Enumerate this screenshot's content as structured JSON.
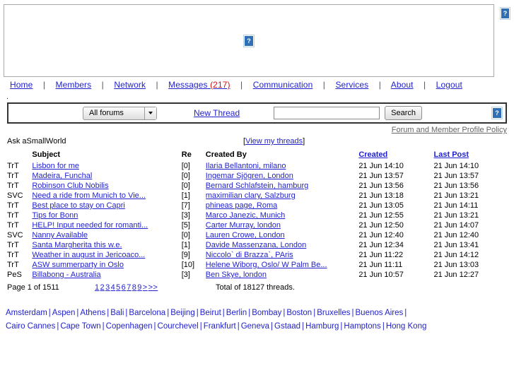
{
  "banner": {
    "center_icon": "broken-image-icon",
    "right_icon": "broken-image-icon"
  },
  "nav": {
    "separator": "|",
    "items": [
      {
        "label": "Home"
      },
      {
        "label": "Members"
      },
      {
        "label": "Network"
      },
      {
        "label": "Messages",
        "count": "(217)"
      },
      {
        "label": "Communication"
      },
      {
        "label": "Services"
      },
      {
        "label": "About"
      },
      {
        "label": "Logout"
      }
    ]
  },
  "stray_text": ".",
  "toolbar": {
    "forum_selected": "All forums",
    "forum_options": [
      "All forums"
    ],
    "new_thread_label": "New Thread",
    "search_value": "",
    "search_placeholder": "",
    "search_button_label": "Search",
    "help_icon": "broken-image-icon"
  },
  "policy": {
    "link_label": "Forum and Member Profile Policy"
  },
  "forum": {
    "name": "Ask aSmallWorld",
    "view_my_threads_open": "[",
    "view_my_threads": "View my threads",
    "view_my_threads_close": "]"
  },
  "table": {
    "headers": {
      "type": "",
      "subject": "Subject",
      "re": "Re",
      "created_by": "Created By",
      "created": "Created",
      "last_post": "Last Post"
    },
    "rows": [
      {
        "type": "TrT",
        "subject": "Lisbon for me",
        "re": "[0]",
        "created_by": "Ilaria Bellantoni, milano",
        "created": "21 Jun 14:10",
        "last_post": "21 Jun 14:10"
      },
      {
        "type": "TrT",
        "subject": "Madeira, Funchal",
        "re": "[0]",
        "created_by": "Ingemar Sjögren, London",
        "created": "21 Jun 13:57",
        "last_post": "21 Jun 13:57"
      },
      {
        "type": "TrT",
        "subject": "Robinson Club Nobilis",
        "re": "[0]",
        "created_by": "Bernard Schlafstein, hamburg",
        "created": "21 Jun 13:56",
        "last_post": "21 Jun 13:56"
      },
      {
        "type": "SVC",
        "subject": "Need a ride from Munich to Vie...",
        "re": "[1]",
        "created_by": "maximilian clary, Salzburg",
        "created": "21 Jun 13:18",
        "last_post": "21 Jun 13:21"
      },
      {
        "type": "TrT",
        "subject": "Best place to stay on Capri",
        "re": "[7]",
        "created_by": "phineas page, Roma",
        "created": "21 Jun 13:05",
        "last_post": "21 Jun 14:11"
      },
      {
        "type": "TrT",
        "subject": "Tips for Bonn",
        "re": "[3]",
        "created_by": "Marco Janezic, Munich",
        "created": "21 Jun 12:55",
        "last_post": "21 Jun 13:21"
      },
      {
        "type": "TrT",
        "subject": "HELP! Input needed for romanti...",
        "re": "[5]",
        "created_by": "Carter Murray, london",
        "created": "21 Jun 12:50",
        "last_post": "21 Jun 14:07"
      },
      {
        "type": "SVC",
        "subject": "Nanny Available",
        "re": "[0]",
        "created_by": "Lauren Crowe, London",
        "created": "21 Jun 12:40",
        "last_post": "21 Jun 12:40"
      },
      {
        "type": "TrT",
        "subject": "Santa Margherita this w.e.",
        "re": "[1]",
        "created_by": "Davide Massenzana, London",
        "created": "21 Jun 12:34",
        "last_post": "21 Jun 13:41"
      },
      {
        "type": "TrT",
        "subject": "Weather in august in Jericoaco...",
        "re": "[9]",
        "created_by": "Niccolo` di Brazza`, PAris",
        "created": "21 Jun 11:22",
        "last_post": "21 Jun 14:12"
      },
      {
        "type": "TrT",
        "subject": "ASW summerparty in Oslo",
        "re": "[10]",
        "created_by": "Helene Wiborg, Oslo/ W Palm Be...",
        "created": "21 Jun 11:11",
        "last_post": "21 Jun 13:03"
      },
      {
        "type": "PeS",
        "subject": "Billabong - Australia",
        "re": "[3]",
        "created_by": "Ben Skye, london",
        "created": "21 Jun 10:57",
        "last_post": "21 Jun 12:27"
      }
    ]
  },
  "pager": {
    "page_of": "Page 1 of 1511",
    "pages": [
      "1",
      "2",
      "3",
      "4",
      "5",
      "6",
      "7",
      "8",
      "9",
      ">",
      ">>"
    ],
    "total": "Total of 18127 threads."
  },
  "footer": {
    "separator": "|",
    "line1": [
      "Amsterdam",
      "Aspen",
      "Athens",
      "Bali",
      "Barcelona",
      "Beijing",
      "Beirut",
      "Berlin",
      "Bombay",
      "Boston",
      "Bruxelles",
      "Buenos Aires"
    ],
    "line2": [
      "Cairo Cannes",
      "Cape Town",
      "Copenhagen",
      "Courchevel",
      "Frankfurt",
      "Geneva",
      "Gstaad",
      "Hamburg",
      "Hamptons",
      "Hong Kong"
    ]
  },
  "colors": {
    "link": "#2222cc",
    "alert": "#cc1111",
    "policy_link": "#666666"
  }
}
